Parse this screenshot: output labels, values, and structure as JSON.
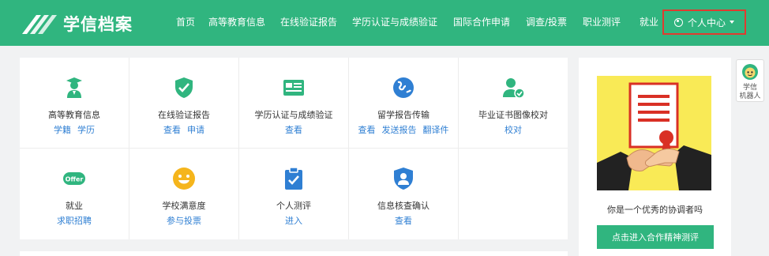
{
  "brand": {
    "name": "学信档案"
  },
  "nav": {
    "items": [
      "首页",
      "高等教育信息",
      "在线验证报告",
      "学历认证与成绩验证",
      "国际合作申请",
      "调查/投票",
      "职业测评",
      "就业"
    ],
    "user_center": "个人中心"
  },
  "services": [
    {
      "title": "高等教育信息",
      "links": [
        "学籍",
        "学历"
      ],
      "icon": "graduate-icon"
    },
    {
      "title": "在线验证报告",
      "links": [
        "查看",
        "申请"
      ],
      "icon": "shield-check-icon"
    },
    {
      "title": "学历认证与成绩验证",
      "links": [
        "查看"
      ],
      "icon": "id-card-icon"
    },
    {
      "title": "留学报告传输",
      "links": [
        "查看",
        "发送报告",
        "翻译件"
      ],
      "icon": "globe-icon"
    },
    {
      "title": "毕业证书图像校对",
      "links": [
        "校对"
      ],
      "icon": "user-check-icon"
    },
    {
      "title": "就业",
      "links": [
        "求职招聘"
      ],
      "icon": "offer-icon"
    },
    {
      "title": "学校满意度",
      "links": [
        "参与投票"
      ],
      "icon": "smile-icon"
    },
    {
      "title": "个人测评",
      "links": [
        "进入"
      ],
      "icon": "clipboard-check-icon"
    },
    {
      "title": "信息核查确认",
      "links": [
        "查看"
      ],
      "icon": "person-shield-icon"
    }
  ],
  "promo": {
    "caption": "你是一个优秀的协调者吗",
    "button": "点击进入合作精神测评"
  },
  "robot": {
    "line1": "学信",
    "line2": "机器人"
  },
  "colors": {
    "brand_green": "#30b57f",
    "link_blue": "#2f7fd3",
    "highlight_red": "#e03b2f"
  }
}
